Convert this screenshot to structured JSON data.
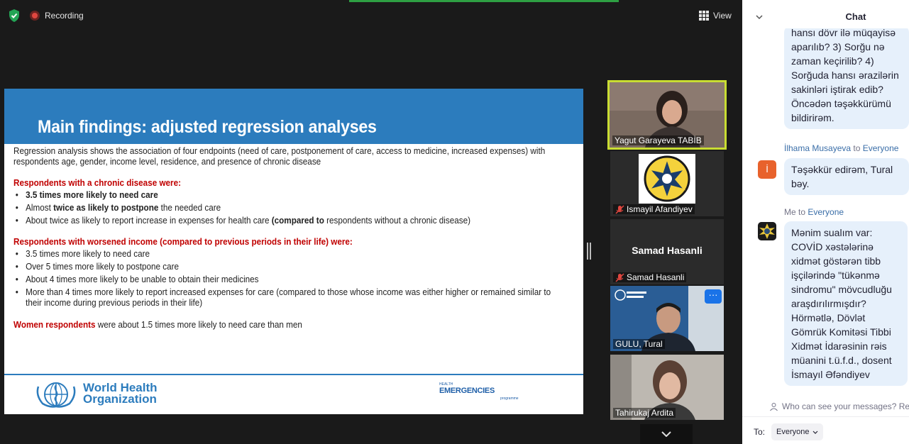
{
  "top_bar": {
    "recording_label": "Recording",
    "view_label": "View"
  },
  "slide": {
    "title": "Main findings: adjusted regression analyses",
    "intro": "Regression analysis shows the association of four endpoints (need of care, postponement of care, access to medicine, increased expenses) with respondents age, gender, income level, residence, and presence of chronic disease",
    "chronic_heading": "Respondents with a chronic disease were:",
    "chronic_b1": "3.5 times more likely to need care",
    "chronic_b2_pre": "Almost ",
    "chronic_b2_bold": "twice as likely to postpone",
    "chronic_b2_post": " the needed care",
    "chronic_b3_pre": "About twice as likely to report increase in expenses for health care ",
    "chronic_b3_bold": "(compared to",
    "chronic_b3_post": " respondents without a chronic disease)",
    "income_heading": "Respondents with worsened income (compared to previous periods in their life) were:",
    "income_bullets": [
      "3.5 times more likely to need care",
      "Over 5 times more likely to postpone care",
      "About 4 times more likely to be unable to obtain their medicines",
      "More than 4 times more likely to report increased expenses for care (compared to those whose income was either higher or remained similar to their income during previous periods in their life)"
    ],
    "women_bold": "Women respondents",
    "women_rest": " were about 1.5 times more likely to need care than men",
    "who_line1": "World Health",
    "who_line2": "Organization",
    "he_small": "HEALTH",
    "he_main": "EMERGENCIES",
    "he_prog": "programme"
  },
  "participants": [
    {
      "name": "Yagut Garayeva TABİB"
    },
    {
      "name": "Ismayil Afandiyev"
    },
    {
      "name": "Samad Hasanli",
      "center_label": "Samad Hasanli"
    },
    {
      "name": "GULU, Tural"
    },
    {
      "name": "Tahirukaj Ardita"
    }
  ],
  "chat": {
    "title": "Chat",
    "msg1": "hansı dövr ilə müqayisə aparılıb?  3) Sorğu nə zaman keçirilib? 4) Sorğuda hansı ərazilərin sakinləri iştirak edib? Öncədən təşəkkürümü bildirirəm.",
    "msg2_sender": "İlhama Musayeva",
    "msg2_to_word": "to",
    "msg2_recipient": "Everyone",
    "msg2_avatar": "İ",
    "msg2": "Təşəkkür edirəm, Tural bəy.",
    "msg3_sender": "Me",
    "msg3_to_word": "to",
    "msg3_recipient": "Everyone",
    "msg3": "Mənim sualım var: COVİD xəstələrinə xidmət göstərən tibb işçilərində \"tükənmə sindromu\" mövcudluğu araşdırılırmışdır? Hörmətlə, Dövlət Gömrük Komitəsi Tibbi Xidmət İdarəsinin rəis müanini t.ü.f.d., dosent İsmayıl Əfəndiyev",
    "visibility_note": "Who can see your messages? Recording",
    "to_label": "To:",
    "to_value": "Everyone"
  },
  "colors": {
    "slide_blue": "#2c7cbd",
    "slide_red": "#c00000",
    "active_speaker": "#c9dd32",
    "chat_bubble": "#e6f0fb",
    "chat_link": "#3a6ea8"
  }
}
